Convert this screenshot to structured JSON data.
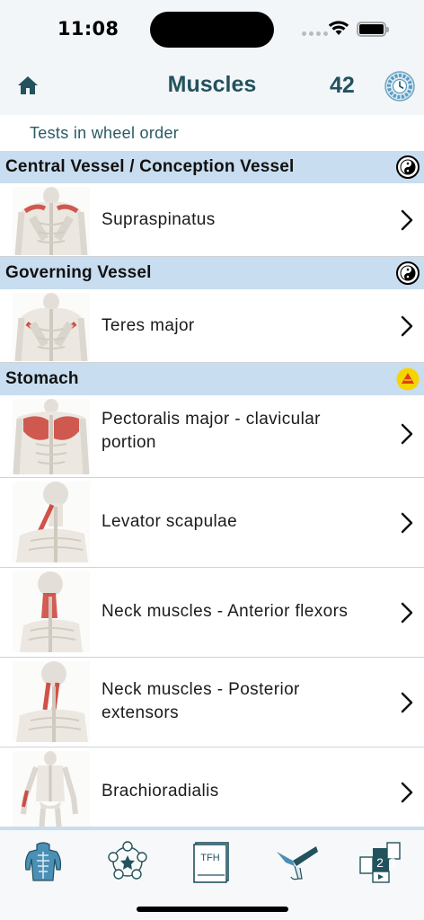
{
  "status": {
    "time": "11:08"
  },
  "nav": {
    "title": "Muscles",
    "count": "42"
  },
  "subtitle": "Tests in wheel order",
  "sections": [
    {
      "title": "Central Vessel / Conception Vessel",
      "badge": "yin-yang-icon",
      "rows": [
        {
          "label": "Supraspinatus",
          "thumb": "torso-back-shoulders"
        }
      ]
    },
    {
      "title": "Governing Vessel",
      "badge": "yin-yang-icon",
      "rows": [
        {
          "label": "Teres major",
          "thumb": "torso-back-shoulders"
        }
      ]
    },
    {
      "title": "Stomach",
      "badge": "earth-triangle-icon",
      "rows": [
        {
          "label": "Pectoralis major - clavicular portion",
          "thumb": "torso-front-chest"
        },
        {
          "label": "Levator scapulae",
          "thumb": "neck-side"
        },
        {
          "label": "Neck muscles - Anterior flexors",
          "thumb": "neck-side"
        },
        {
          "label": "Neck muscles - Posterior extensors",
          "thumb": "neck-side"
        },
        {
          "label": "Brachioradialis",
          "thumb": "full-body-arm"
        }
      ]
    }
  ],
  "tabs": [
    {
      "name": "tab-muscles",
      "icon": "muscle-body-icon"
    },
    {
      "name": "tab-wheel",
      "icon": "five-element-wheel-icon"
    },
    {
      "name": "tab-tfh-book",
      "icon": "book-icon",
      "text": "TFH"
    },
    {
      "name": "tab-test",
      "icon": "arm-test-icon"
    },
    {
      "name": "tab-sequence",
      "icon": "numbered-steps-icon",
      "text": "123"
    }
  ],
  "colors": {
    "accent": "#22525e",
    "section": "#c8ddef",
    "badge_yellow": "#f5d400",
    "badge_red": "#e33a1a",
    "muscle_red": "#c9352b"
  }
}
